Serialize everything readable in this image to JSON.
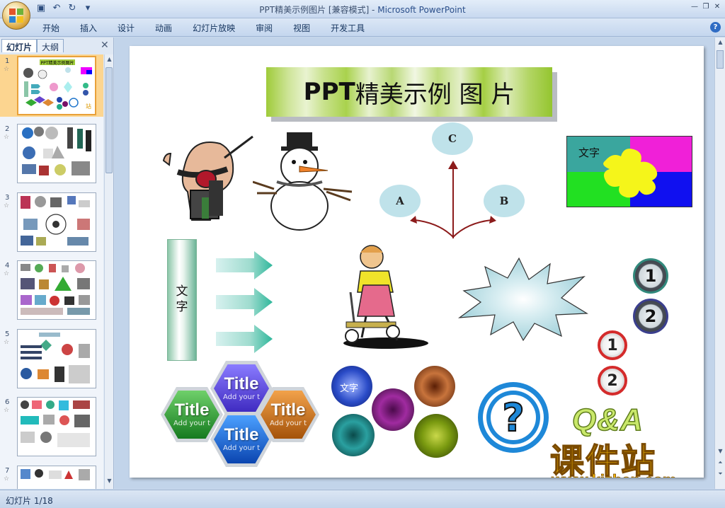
{
  "window": {
    "title": "PPT精美示例图片 [兼容模式] - ",
    "app_name": "Microsoft PowerPoint"
  },
  "ribbon": {
    "tabs": [
      "开始",
      "插入",
      "设计",
      "动画",
      "幻灯片放映",
      "审阅",
      "视图",
      "开发工具"
    ]
  },
  "left_pane": {
    "tabs": [
      "幻灯片",
      "大纲"
    ],
    "active_tab": "幻灯片",
    "thumbnails": [
      {
        "num": "1",
        "active": true
      },
      {
        "num": "2",
        "active": false
      },
      {
        "num": "3",
        "active": false
      },
      {
        "num": "4",
        "active": false
      },
      {
        "num": "5",
        "active": false
      },
      {
        "num": "6",
        "active": false
      },
      {
        "num": "7",
        "active": false
      }
    ],
    "thumb1_title": "PPT精美示例图片"
  },
  "slide": {
    "title_bold": "PPT",
    "title_rest": "精美示例 图 片",
    "nodes": {
      "a": "A",
      "b": "B",
      "c": "C"
    },
    "puzzle_label": "文字",
    "vertical_text": "文字",
    "hex_titles": [
      "Title",
      "Title",
      "Title",
      "Title"
    ],
    "hex_sub": "Add your t",
    "orb_label": "文字",
    "numbers_dark": [
      "1",
      "2"
    ],
    "numbers_red": [
      "1",
      "2"
    ],
    "question_mark": "?",
    "watermark": {
      "qa": "Q&A",
      "site_cn": "课件站",
      "url": "www.kjzhan.com"
    }
  },
  "status": {
    "slide_indicator": "幻灯片 1/18"
  },
  "colors": {
    "ribbon_bg": "#c4d6ee",
    "active_thumb": "#fcd590",
    "title_green": "#9fcb3a",
    "watermark_gold": "#f0b400"
  }
}
